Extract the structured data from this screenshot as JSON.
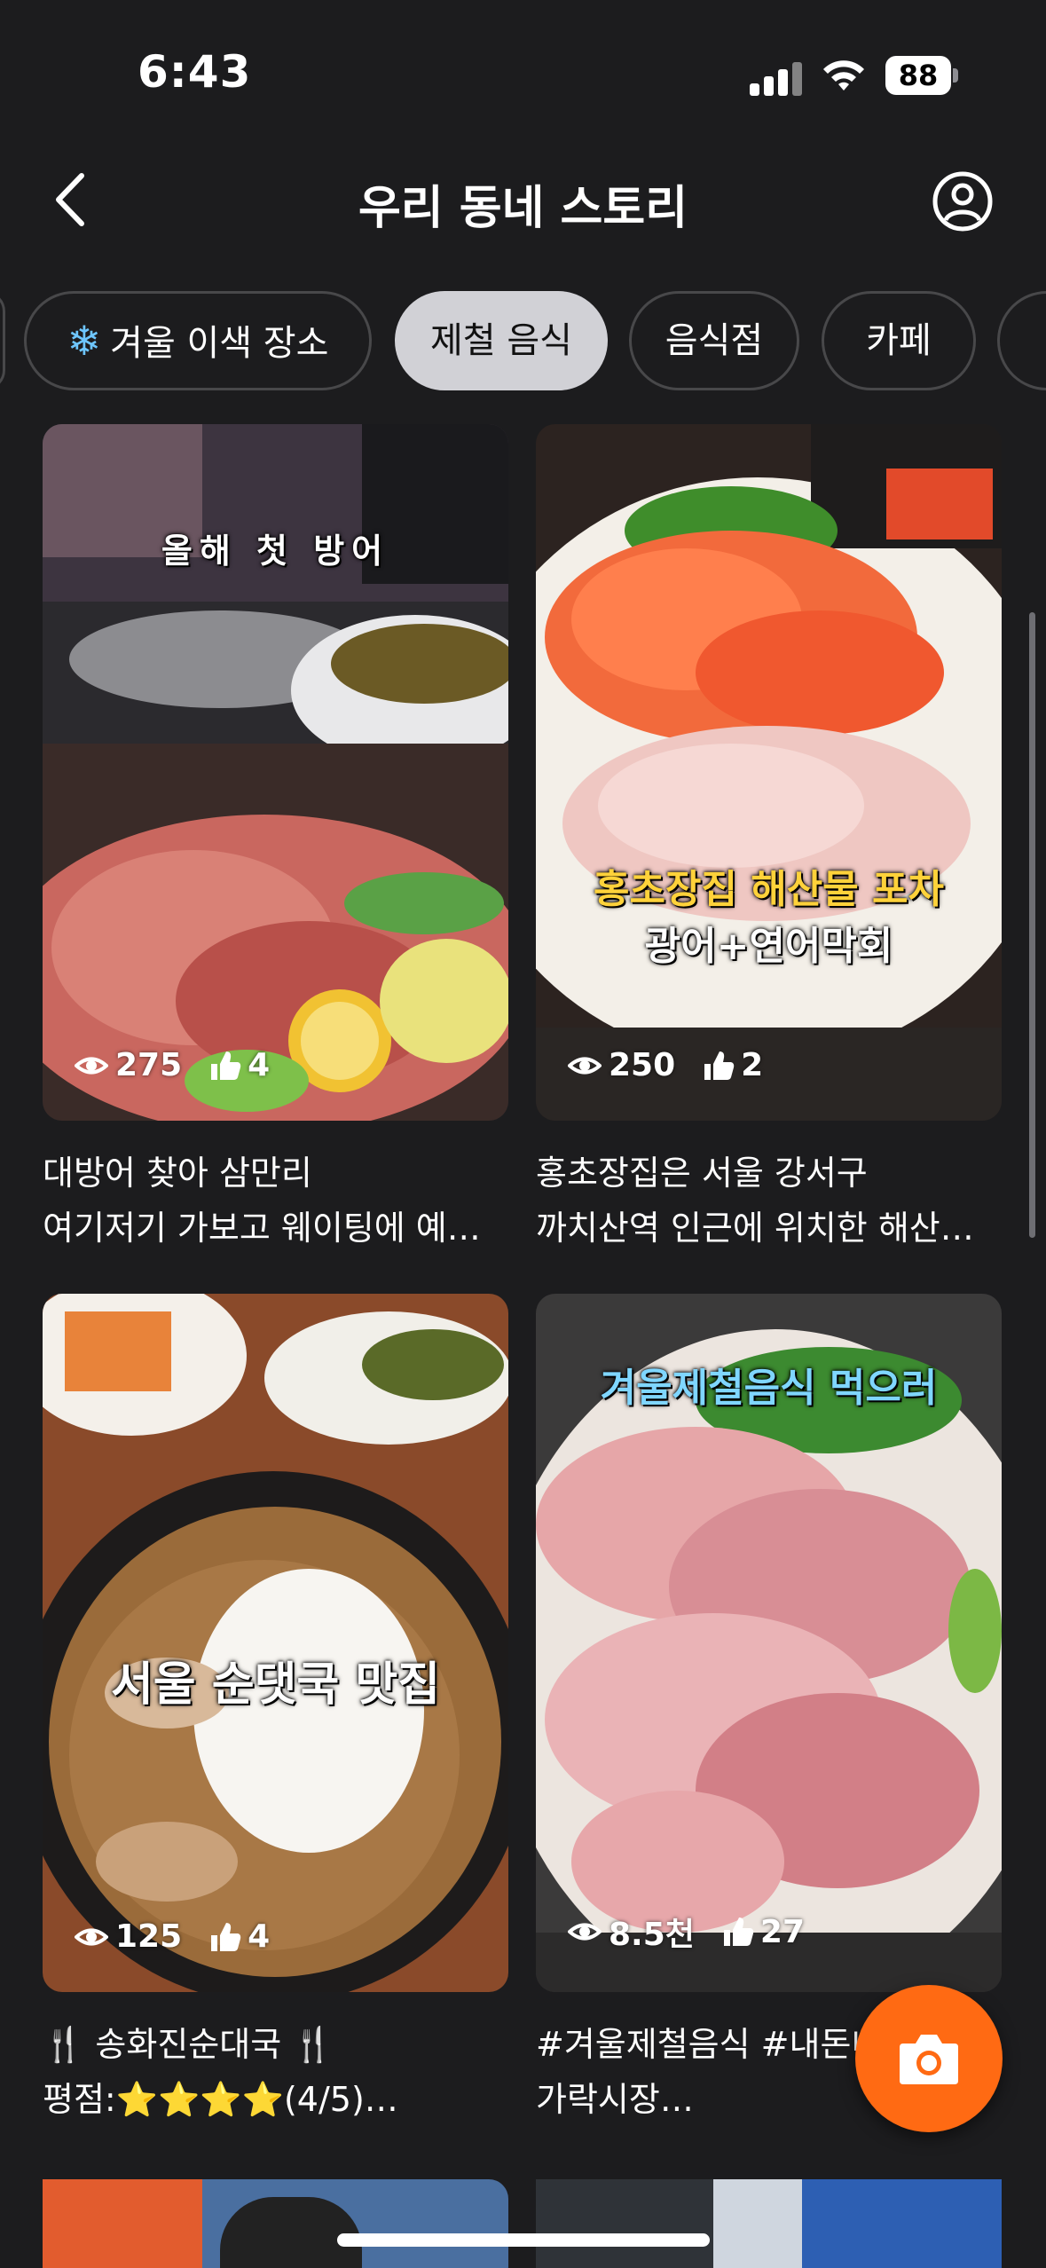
{
  "status_bar": {
    "time": "6:43",
    "battery": "88"
  },
  "header": {
    "title": "우리 동네 스토리",
    "back_icon": "chevron-left-icon",
    "profile_icon": "profile-icon"
  },
  "chips": [
    {
      "label": "겨울 이색 장소",
      "icon": "snowflake-icon",
      "active": false
    },
    {
      "label": "제철 음식",
      "active": true
    },
    {
      "label": "음식점",
      "active": false
    },
    {
      "label": "카페",
      "active": false
    }
  ],
  "cards": [
    {
      "overlay": "올해 첫 방어",
      "views": "275",
      "likes": "4",
      "line1": "대방어 찾아 삼만리",
      "line2": "여기저기 가보고 웨이팅에 예…"
    },
    {
      "overlay1": "홍초장집 해산물 포차",
      "overlay2": "광어+연어막회",
      "views": "250",
      "likes": "2",
      "line1": "홍초장집은 서울 강서구",
      "line2": "까치산역 인근에 위치한 해산…"
    },
    {
      "overlay": "서울 순댓국 맛집",
      "views": "125",
      "likes": "4",
      "line1": "🍴 송화진순대국 🍴",
      "line2": "평점:⭐⭐⭐⭐(4/5)…"
    },
    {
      "overlay": "겨울제철음식 먹으러",
      "views": "8.5천",
      "likes": "27",
      "line1": "#겨울제철음식 #내돈내산",
      "line2": "가락시장…"
    }
  ],
  "colors": {
    "accent": "#ff6a13",
    "background": "#1c1c1e",
    "chip_active": "#d1d1d6"
  },
  "fab": {
    "icon": "camera-icon"
  }
}
